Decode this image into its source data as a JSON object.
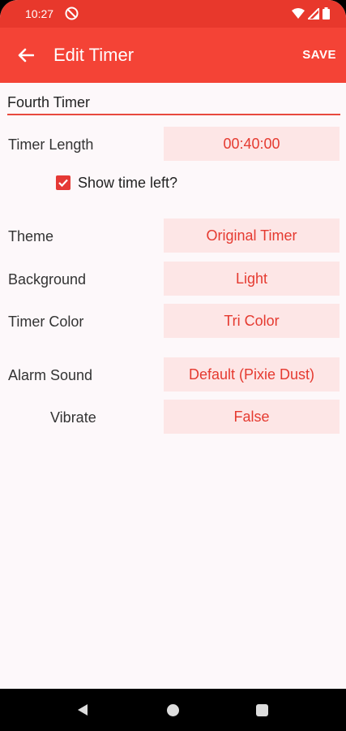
{
  "status_bar": {
    "time": "10:27",
    "icons": [
      "do-not-disturb-icon",
      "wifi-icon",
      "signal-icon",
      "battery-icon"
    ]
  },
  "app_bar": {
    "title": "Edit Timer",
    "save_label": "SAVE",
    "back_icon": "arrow-back-icon"
  },
  "timer_name": "Fourth Timer",
  "fields": {
    "timer_length": {
      "label": "Timer Length",
      "value": "00:40:00"
    },
    "show_time_left": {
      "label": "Show time left?",
      "checked": true
    },
    "theme": {
      "label": "Theme",
      "value": "Original Timer"
    },
    "background": {
      "label": "Background",
      "value": "Light"
    },
    "timer_color": {
      "label": "Timer Color",
      "value": "Tri Color"
    },
    "alarm_sound": {
      "label": "Alarm Sound",
      "value": "Default (Pixie Dust)"
    },
    "vibrate": {
      "label": "Vibrate",
      "value": "False"
    }
  },
  "colors": {
    "primary": "#f44336",
    "status_bar": "#e8382c",
    "value_bg": "#fde6e6",
    "value_text": "#e53a30"
  }
}
